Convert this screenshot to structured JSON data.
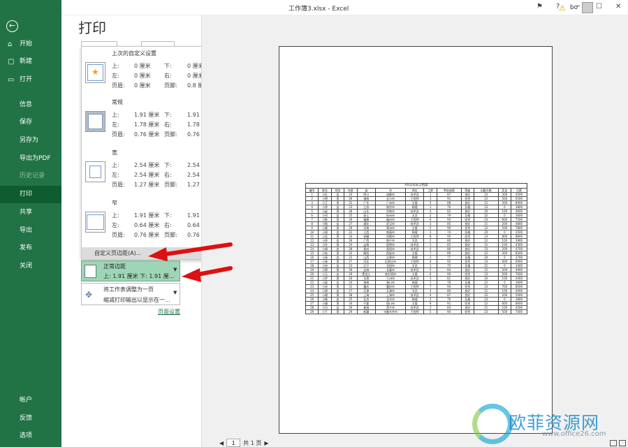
{
  "window": {
    "title": "工作簿3.xlsx  -  Excel",
    "user": "bo"
  },
  "sidebar": {
    "items": [
      {
        "label": "开始",
        "icon": "home-icon",
        "active": false
      },
      {
        "label": "新建",
        "icon": "new-doc-icon",
        "active": false
      },
      {
        "label": "打开",
        "icon": "open-folder-icon",
        "active": false
      },
      {
        "label": "信息",
        "active": false
      },
      {
        "label": "保存",
        "active": false
      },
      {
        "label": "另存为",
        "active": false
      },
      {
        "label": "导出为PDF",
        "active": false
      },
      {
        "label": "历史记录",
        "disabled": true
      },
      {
        "label": "打印",
        "active": true
      },
      {
        "label": "共享"
      },
      {
        "label": "导出"
      },
      {
        "label": "发布"
      },
      {
        "label": "关闭"
      },
      {
        "label": "帐户"
      },
      {
        "label": "反馈"
      },
      {
        "label": "选项"
      }
    ]
  },
  "page_title": "打印",
  "margins": {
    "options": [
      {
        "name": "上次的自定义设置",
        "rows": [
          [
            "上:",
            "0 厘米",
            "下:",
            "0 厘米"
          ],
          [
            "左:",
            "0 厘米",
            "右:",
            "0 厘米"
          ],
          [
            "页眉:",
            "0 厘米",
            "页脚:",
            "0.8 厘米"
          ]
        ]
      },
      {
        "name": "常规",
        "rows": [
          [
            "上:",
            "1.91 厘米",
            "下:",
            "1.91 厘米"
          ],
          [
            "左:",
            "1.78 厘米",
            "右:",
            "1.78 厘米"
          ],
          [
            "页眉:",
            "0.76 厘米",
            "页脚:",
            "0.76 厘米"
          ]
        ]
      },
      {
        "name": "宽",
        "rows": [
          [
            "上:",
            "2.54 厘米",
            "下:",
            "2.54 厘米"
          ],
          [
            "左:",
            "2.54 厘米",
            "右:",
            "2.54 厘米"
          ],
          [
            "页眉:",
            "1.27 厘米",
            "页脚:",
            "1.27 厘米"
          ]
        ]
      },
      {
        "name": "窄",
        "rows": [
          [
            "上:",
            "1.91 厘米",
            "下:",
            "1.91 厘米"
          ],
          [
            "左:",
            "0.64 厘米",
            "右:",
            "0.64 厘米"
          ],
          [
            "页眉:",
            "0.76 厘米",
            "页脚:",
            "0.76 厘米"
          ]
        ]
      }
    ],
    "custom_label": "自定义页边距(A)..."
  },
  "current_margin": {
    "line1": "正常边距",
    "line2": "上: 1.91 厘米 下: 1.91 厘..."
  },
  "scaling": {
    "line1": "将工作表调整为一页",
    "line2": "缩减打印输出以显示在一..."
  },
  "page_setup_link": "页面设置",
  "sheet": {
    "title": "XX公司员工档案",
    "headers": [
      "编号",
      "姓名",
      "性别",
      "年龄",
      "省",
      "市",
      "岗位",
      "工龄",
      "考核成绩",
      "等级",
      "出勤天数",
      "奖金",
      "月薪"
    ],
    "rows": [
      [
        "1",
        "小红",
        "女",
        "24",
        "四川",
        "成都市",
        "技术员",
        "1",
        "87",
        "良好",
        "23",
        "300",
        "4500"
      ],
      [
        "2",
        "小明",
        "男",
        "26",
        "湖南",
        "长沙市",
        "工程师",
        "3",
        "91",
        "优秀",
        "22",
        "500",
        "6500"
      ],
      [
        "3",
        "小王",
        "男",
        "31",
        "广东",
        "广州市",
        "主管",
        "5",
        "88",
        "良好",
        "21",
        "200",
        "8000"
      ],
      [
        "4",
        "小李",
        "女",
        "23",
        "江苏",
        "南京市",
        "助理",
        "1",
        "76",
        "及格",
        "23",
        "0",
        "3800"
      ],
      [
        "5",
        "小赵",
        "男",
        "28",
        "山东",
        "济南市",
        "技术员",
        "4",
        "82",
        "良好",
        "20",
        "100",
        "4600"
      ],
      [
        "6",
        "小刘",
        "女",
        "25",
        "浙江",
        "杭州市",
        "文员",
        "2",
        "79",
        "及格",
        "22",
        "0",
        "3600"
      ],
      [
        "7",
        "小陈",
        "男",
        "30",
        "福建",
        "福州市",
        "工程师",
        "6",
        "93",
        "优秀",
        "23",
        "600",
        "7200"
      ],
      [
        "8",
        "小杨",
        "女",
        "27",
        "湖北",
        "武汉市",
        "技术员",
        "3",
        "85",
        "良好",
        "21",
        "200",
        "4800"
      ],
      [
        "9",
        "小黄",
        "男",
        "29",
        "河南",
        "郑州市",
        "主管",
        "5",
        "90",
        "优秀",
        "22",
        "500",
        "7800"
      ],
      [
        "10",
        "小周",
        "女",
        "22",
        "江西",
        "南昌市",
        "助理",
        "1",
        "74",
        "及格",
        "20",
        "0",
        "3500"
      ],
      [
        "11",
        "小吴",
        "男",
        "33",
        "安徽",
        "合肥市",
        "工程师",
        "8",
        "95",
        "优秀",
        "23",
        "800",
        "8800"
      ],
      [
        "12",
        "小徐",
        "女",
        "26",
        "广西",
        "南宁市",
        "文员",
        "2",
        "80",
        "良好",
        "22",
        "100",
        "3900"
      ],
      [
        "13",
        "小孙",
        "男",
        "24",
        "云南",
        "昆明市",
        "技术员",
        "1",
        "83",
        "良好",
        "21",
        "100",
        "4300"
      ],
      [
        "14",
        "小胡",
        "女",
        "28",
        "贵州",
        "贵阳市",
        "技术员",
        "4",
        "86",
        "良好",
        "23",
        "200",
        "4700"
      ],
      [
        "15",
        "小朱",
        "男",
        "32",
        "陕西",
        "西安市",
        "主管",
        "7",
        "89",
        "良好",
        "22",
        "300",
        "8200"
      ],
      [
        "16",
        "小高",
        "女",
        "25",
        "山西",
        "太原市",
        "助理",
        "2",
        "77",
        "及格",
        "20",
        "0",
        "3700"
      ],
      [
        "17",
        "小林",
        "男",
        "27",
        "河北",
        "石家庄市",
        "工程师",
        "4",
        "92",
        "优秀",
        "23",
        "600",
        "6900"
      ],
      [
        "18",
        "小何",
        "女",
        "23",
        "辽宁",
        "沈阳市",
        "文员",
        "1",
        "75",
        "及格",
        "21",
        "0",
        "3400"
      ],
      [
        "19",
        "小郭",
        "男",
        "30",
        "吉林",
        "长春市",
        "技术员",
        "5",
        "84",
        "良好",
        "22",
        "200",
        "4900"
      ],
      [
        "20",
        "小马",
        "女",
        "29",
        "黑龙江",
        "哈尔滨市",
        "主管",
        "6",
        "90",
        "优秀",
        "23",
        "500",
        "7600"
      ],
      [
        "21",
        "小罗",
        "男",
        "26",
        "甘肃",
        "兰州市",
        "技术员",
        "3",
        "81",
        "良好",
        "20",
        "100",
        "4400"
      ],
      [
        "22",
        "小梁",
        "女",
        "24",
        "海南",
        "海口市",
        "助理",
        "1",
        "78",
        "及格",
        "22",
        "0",
        "3600"
      ],
      [
        "23",
        "小宋",
        "男",
        "31",
        "重庆",
        "重庆市",
        "工程师",
        "7",
        "94",
        "优秀",
        "23",
        "700",
        "8500"
      ],
      [
        "24",
        "小郑",
        "女",
        "27",
        "天津",
        "天津市",
        "文员",
        "3",
        "80",
        "良好",
        "21",
        "100",
        "4000"
      ],
      [
        "25",
        "小谢",
        "男",
        "28",
        "上海",
        "上海市",
        "技术员",
        "4",
        "87",
        "良好",
        "22",
        "200",
        "5000"
      ],
      [
        "26",
        "小韩",
        "女",
        "25",
        "北京",
        "北京市",
        "助理",
        "2",
        "76",
        "及格",
        "23",
        "0",
        "3800"
      ],
      [
        "27",
        "小唐",
        "男",
        "34",
        "宁夏",
        "银川市",
        "主管",
        "9",
        "91",
        "优秀",
        "22",
        "600",
        "8600"
      ],
      [
        "28",
        "小冯",
        "女",
        "26",
        "青海",
        "西宁市",
        "技术员",
        "2",
        "83",
        "良好",
        "21",
        "100",
        "4500"
      ],
      [
        "29",
        "小于",
        "男",
        "29",
        "新疆",
        "乌鲁木齐市",
        "工程师",
        "5",
        "90",
        "优秀",
        "23",
        "500",
        "7400"
      ]
    ]
  },
  "nav": {
    "page_input": "1",
    "total": "共 1 页"
  },
  "watermark": {
    "text": "欧菲资源网",
    "sub": "www.office26.com"
  }
}
